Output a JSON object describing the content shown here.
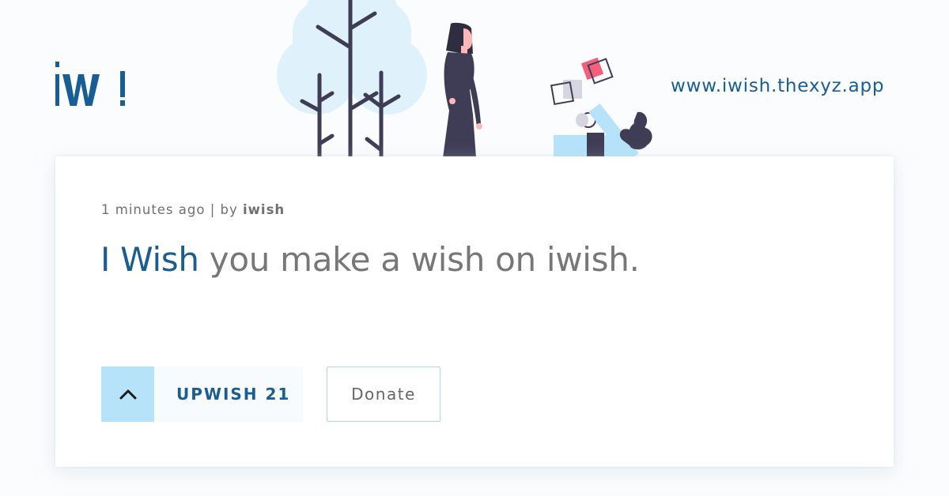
{
  "header": {
    "logo_text": "iW!",
    "site_url": "www.iwish.thexyz.app"
  },
  "wish": {
    "time_ago": "1 minutes ago",
    "separator": " | by ",
    "author": "iwish",
    "prefix": "I Wish",
    "body": " you make a wish on iwish."
  },
  "actions": {
    "upwish_label": "UPWISH 21",
    "donate_label": "Donate"
  },
  "colors": {
    "brand_blue": "#185d93",
    "accent_light_blue": "#b6e3f9",
    "illustration_dark": "#3f3d56",
    "illustration_pink": "#f4607b"
  },
  "icons": {
    "upwish_arrow": "chevron-up-icon"
  }
}
